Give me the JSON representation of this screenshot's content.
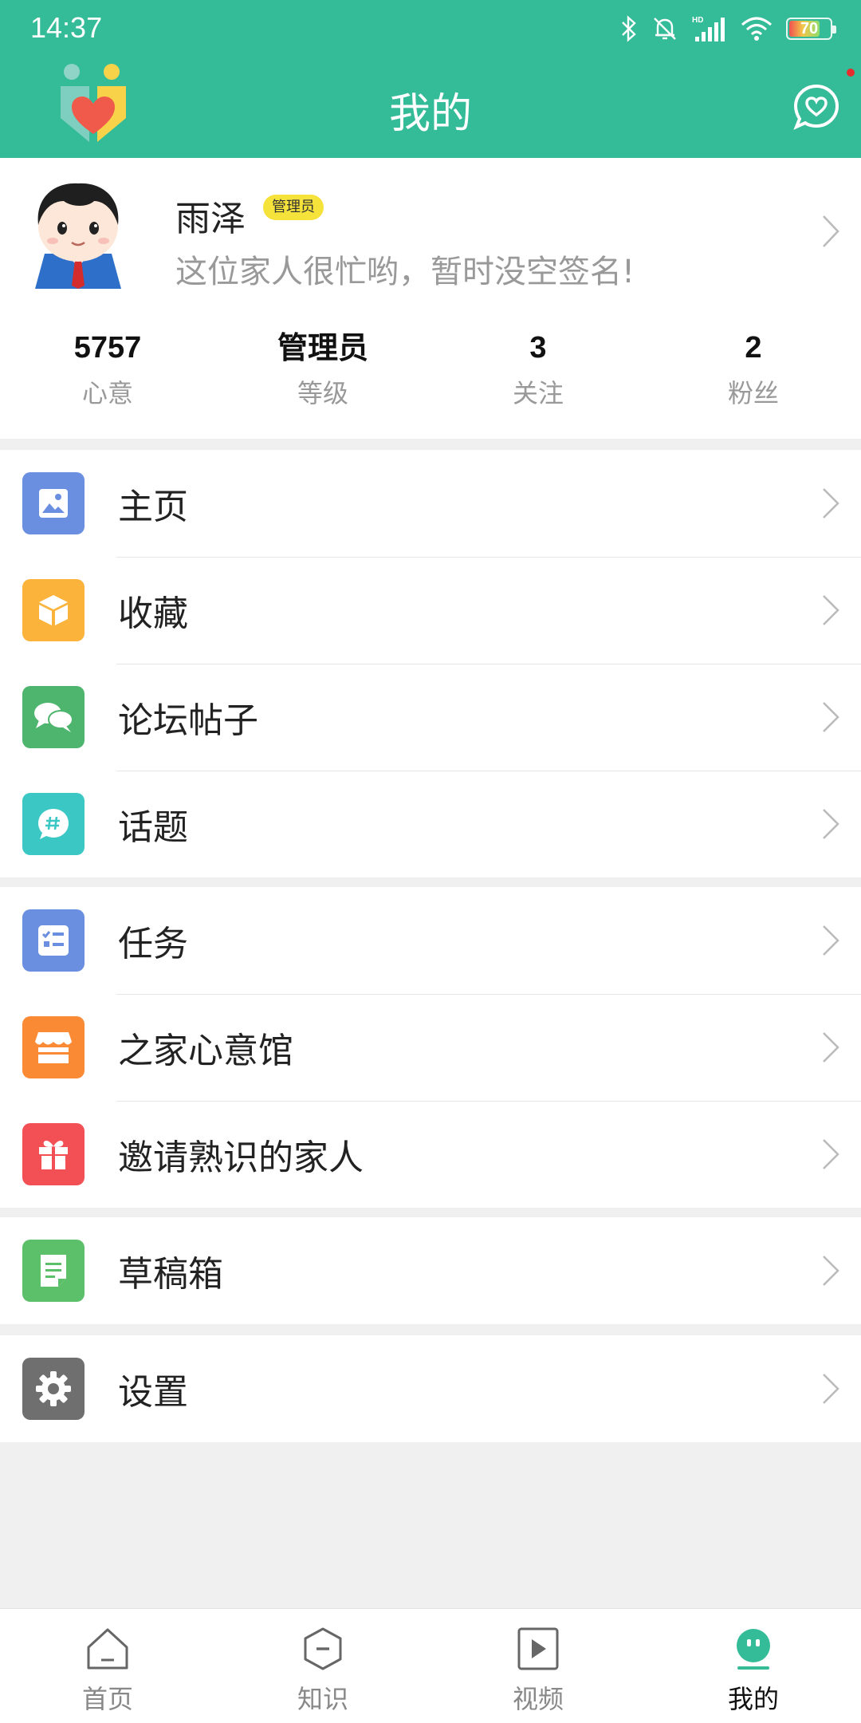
{
  "status_bar": {
    "time": "14:37",
    "battery": "70"
  },
  "header": {
    "title": "我的"
  },
  "profile": {
    "name": "雨泽",
    "badge": "管理员",
    "signature": "这位家人很忙哟，暂时没空签名!"
  },
  "stats": [
    {
      "value": "5757",
      "label": "心意"
    },
    {
      "value": "管理员",
      "label": "等级"
    },
    {
      "value": "3",
      "label": "关注"
    },
    {
      "value": "2",
      "label": "粉丝"
    }
  ],
  "menu": {
    "group1": [
      {
        "label": "主页",
        "icon": "image-icon",
        "color": "#6b8fe0"
      },
      {
        "label": "收藏",
        "icon": "box-icon",
        "color": "#fbb33b"
      },
      {
        "label": "论坛帖子",
        "icon": "chat-bubbles-icon",
        "color": "#4db56e"
      },
      {
        "label": "话题",
        "icon": "hashtag-icon",
        "color": "#3bc8c4"
      }
    ],
    "group2": [
      {
        "label": "任务",
        "icon": "task-list-icon",
        "color": "#6b8fe0"
      },
      {
        "label": "之家心意馆",
        "icon": "store-icon",
        "color": "#fb8a35"
      },
      {
        "label": "邀请熟识的家人",
        "icon": "gift-icon",
        "color": "#f25055"
      }
    ],
    "group3": [
      {
        "label": "草稿箱",
        "icon": "draft-icon",
        "color": "#5cbf6a"
      }
    ],
    "group4": [
      {
        "label": "设置",
        "icon": "gear-icon",
        "color": "#6f6f6f"
      }
    ]
  },
  "bottom_nav": [
    {
      "label": "首页",
      "icon": "home-icon"
    },
    {
      "label": "知识",
      "icon": "knowledge-icon"
    },
    {
      "label": "视频",
      "icon": "video-icon"
    },
    {
      "label": "我的",
      "icon": "me-icon",
      "active": true
    }
  ]
}
